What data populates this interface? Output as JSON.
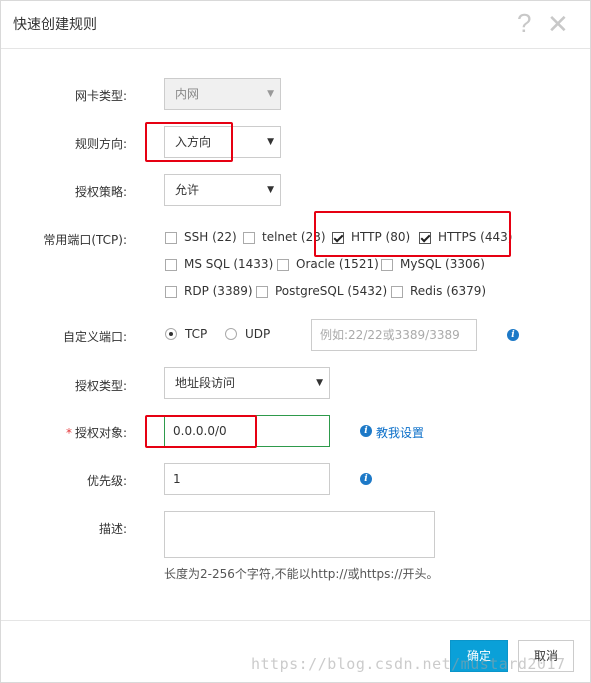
{
  "dialog": {
    "title": "快速创建规则",
    "help_glyph": "?",
    "close_glyph": "✕"
  },
  "form": {
    "nic_type": {
      "label": "网卡类型:",
      "value": "内网"
    },
    "direction": {
      "label": "规则方向:",
      "value": "入方向"
    },
    "policy": {
      "label": "授权策略:",
      "value": "允许"
    },
    "common_ports": {
      "label": "常用端口(TCP):",
      "options": [
        {
          "label": "SSH (22)",
          "checked": false
        },
        {
          "label": "telnet (23)",
          "checked": false
        },
        {
          "label": "HTTP (80)",
          "checked": true
        },
        {
          "label": "HTTPS (443)",
          "checked": true
        },
        {
          "label": "MS SQL (1433)",
          "checked": false
        },
        {
          "label": "Oracle (1521)",
          "checked": false
        },
        {
          "label": "MySQL (3306)",
          "checked": false
        },
        {
          "label": "RDP (3389)",
          "checked": false
        },
        {
          "label": "PostgreSQL (5432)",
          "checked": false
        },
        {
          "label": "Redis (6379)",
          "checked": false
        }
      ]
    },
    "custom_port": {
      "label": "自定义端口:",
      "tcp_label": "TCP",
      "udp_label": "UDP",
      "selected": "TCP",
      "placeholder": "例如:22/22或3389/3389"
    },
    "auth_type": {
      "label": "授权类型:",
      "value": "地址段访问"
    },
    "auth_object": {
      "label": "授权对象:",
      "required_mark": "*",
      "value": "0.0.0.0/0",
      "help_link": "教我设置"
    },
    "priority": {
      "label": "优先级:",
      "value": "1"
    },
    "description": {
      "label": "描述:",
      "value": "",
      "hint": "长度为2-256个字符,不能以http://或https://开头。"
    }
  },
  "footer": {
    "confirm_label": "确定",
    "cancel_label": "取消"
  },
  "watermark": "https://blog.csdn.net/mustard2017",
  "colors": {
    "primary": "#0aa0d8",
    "link": "#0b6fc9",
    "highlight": "#e60012",
    "focus_border": "#2e9a4b",
    "required": "#e4393c"
  },
  "icons": {
    "help": "question-mark",
    "close": "x-mark",
    "info": "info-circle",
    "caret": "caret-down"
  }
}
